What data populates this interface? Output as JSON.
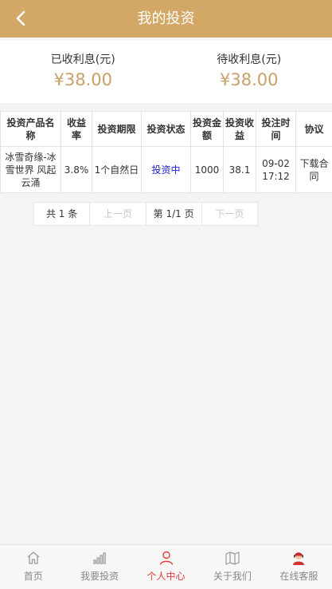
{
  "header": {
    "title": "我的投资",
    "back_icon": "chevron-left-icon"
  },
  "summary": {
    "received": {
      "label": "已收利息(元)",
      "value": "¥38.00"
    },
    "pending": {
      "label": "待收利息(元)",
      "value": "¥38.00"
    }
  },
  "table": {
    "headers": [
      "投资产品名称",
      "收益率",
      "投资期限",
      "投资状态",
      "投资金额",
      "投资收益",
      "投注时间",
      "协议"
    ],
    "rows": [
      [
        "冰雪奇缘-冰雪世界 风起云涌",
        "3.8%",
        "1个自然日",
        "投资中",
        "1000",
        "38.1",
        "09-02 17:12",
        "下载合同"
      ]
    ]
  },
  "pager": {
    "total": "共 1 条",
    "prev": "上一页",
    "current": "第 1/1 页",
    "next": "下一页"
  },
  "tabbar": {
    "items": [
      {
        "label": "首页",
        "icon": "home-icon"
      },
      {
        "label": "我要投资",
        "icon": "bar-chart-icon"
      },
      {
        "label": "个人中心",
        "icon": "user-icon",
        "active": true
      },
      {
        "label": "关于我们",
        "icon": "map-icon"
      },
      {
        "label": "在线客服",
        "icon": "customer-service-icon"
      }
    ]
  },
  "colors": {
    "header_bg": "#d3a866",
    "amount": "#c9a06a",
    "active_tab": "#e43b3b",
    "status_link": "#1e1ec8"
  }
}
